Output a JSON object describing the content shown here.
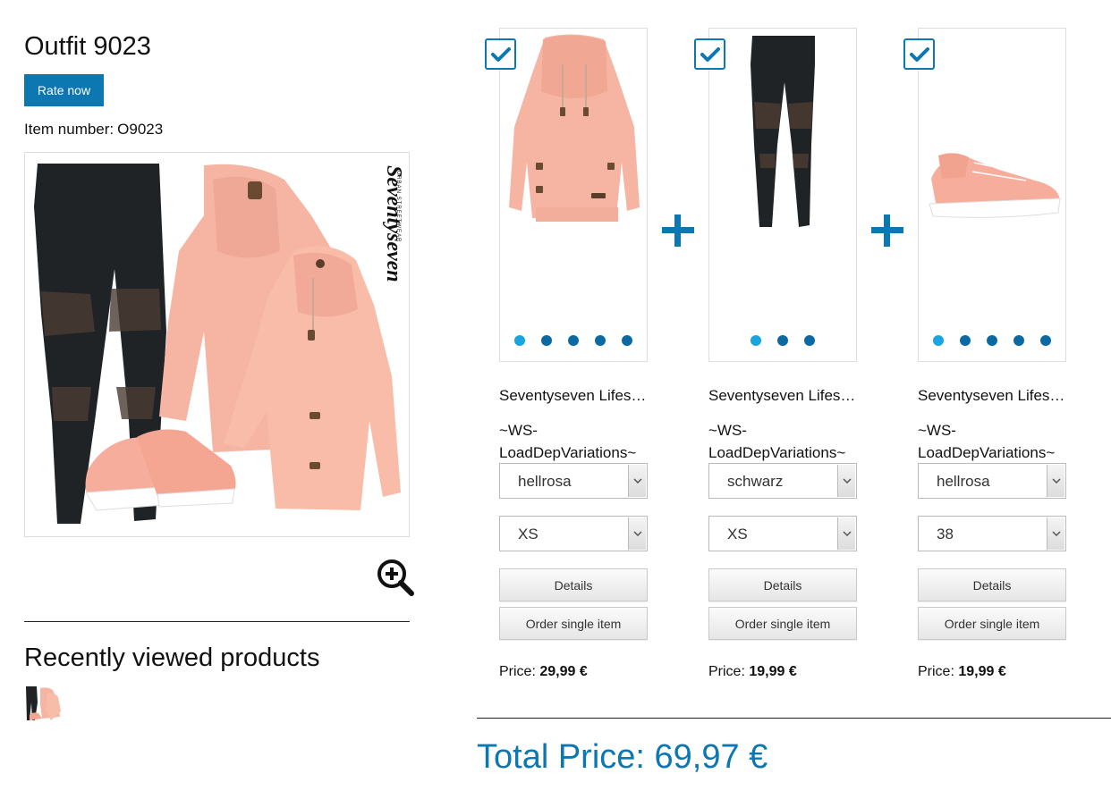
{
  "outfit": {
    "title": "Outfit 9023",
    "rate_label": "Rate now",
    "item_number_label": "Item number:",
    "item_number": "O9023",
    "brand_watermark": "Seventyseven",
    "brand_sub": "URBAN STREETWEAR"
  },
  "recent": {
    "title": "Recently viewed products"
  },
  "products": [
    {
      "name": "Seventyseven Lifes…",
      "variation": "~WS-LoadDepVariations~",
      "color": "hellrosa",
      "size": "XS",
      "details_label": "Details",
      "order_label": "Order single item",
      "price_label": "Price:",
      "price": "29,99 €",
      "image": "pink-hoodie",
      "dots": 5,
      "checked": true
    },
    {
      "name": "Seventyseven Lifes…",
      "variation": "~WS-LoadDepVariations~",
      "color": "schwarz",
      "size": "XS",
      "details_label": "Details",
      "order_label": "Order single item",
      "price_label": "Price:",
      "price": "19,99 €",
      "image": "black-leggings",
      "dots": 3,
      "checked": true
    },
    {
      "name": "Seventyseven Lifes…",
      "variation": "~WS-LoadDepVariations~",
      "color": "hellrosa",
      "size": "38",
      "details_label": "Details",
      "order_label": "Order single item",
      "price_label": "Price:",
      "price": "19,99 €",
      "image": "pink-sneaker",
      "dots": 5,
      "checked": true
    }
  ],
  "total": {
    "label": "Total Price: 69,97 €"
  },
  "colors": {
    "accent": "#0c77b1",
    "dot_active": "#1aa5e0",
    "dot": "#0c6aa3"
  },
  "icons": [
    "checkbox-check-icon",
    "plus-icon",
    "zoom-in-icon",
    "chevron-down-icon"
  ]
}
